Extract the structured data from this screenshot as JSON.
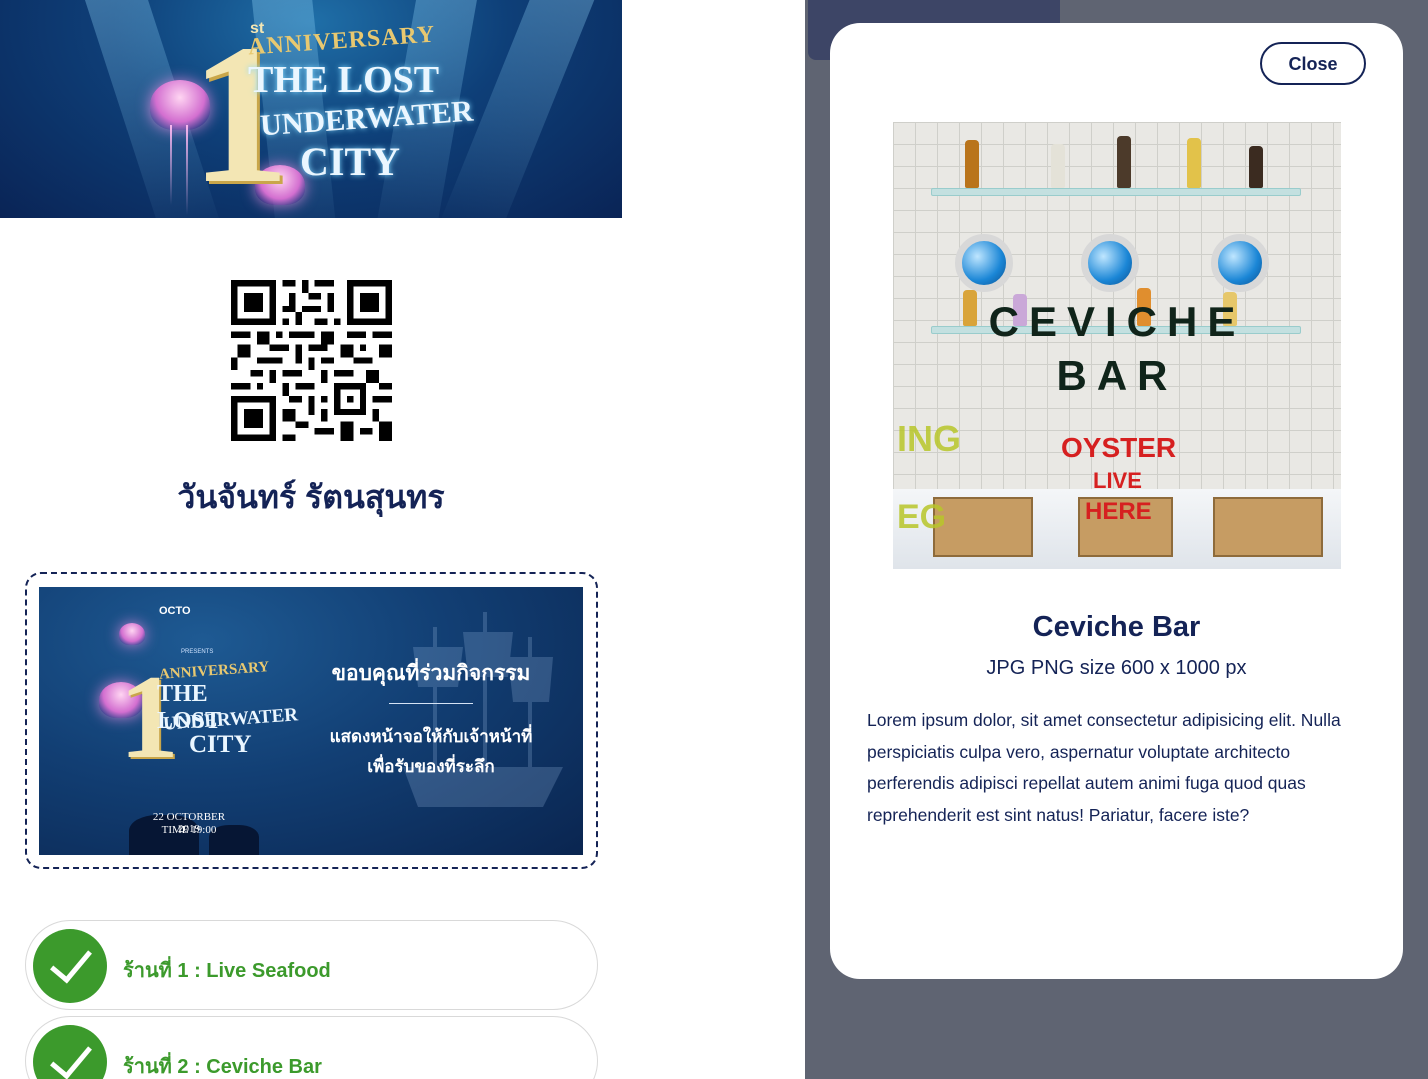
{
  "banner": {
    "logo_sup": "st",
    "logo_number": "1",
    "logo_anniversary": "ANNIVERSARY",
    "logo_line1": "THE LOST",
    "logo_line2": "UNDERWATER",
    "logo_line3": "CITY"
  },
  "user": {
    "name": "วันจันทร์ รัตนสุนทร"
  },
  "ticket": {
    "brand": "OCTO",
    "presents": "PRESENTS",
    "thanks": "ขอบคุณที่ร่วมกิจกรรม",
    "note_line1": "แสดงหน้าจอให้กับเจ้าหน้าที่",
    "note_line2": "เพื่อรับของที่ระลึก",
    "date": "22 OCTORBER 2019",
    "time": "TIME 19:00"
  },
  "shops": [
    {
      "label": "ร้านที่ 1 : Live Seafood",
      "status": "checked"
    },
    {
      "label": "ร้านที่ 2 : Ceviche Bar",
      "status": "checked"
    }
  ],
  "modal": {
    "close_label": "Close",
    "photo_sign_line1": "CEVICHE",
    "photo_sign_line2": "BAR",
    "photo_sign_oyster": "OYSTER",
    "photo_sign_live": "LIVE",
    "photo_sign_here": "HERE",
    "title": "Ceviche Bar",
    "subtitle": "JPG PNG size 600 x 1000 px",
    "description": "Lorem ipsum dolor, sit amet consectetur adipisicing elit. Nulla perspiciatis culpa vero, aspernatur voluptate architecto perferendis adipisci repellat autem animi fuga quod quas reprehenderit est sint natus! Pariatur, facere iste?"
  },
  "colors": {
    "primary_navy": "#142356",
    "success_green": "#3c9a2c",
    "overlay_gray": "#5f6472"
  }
}
